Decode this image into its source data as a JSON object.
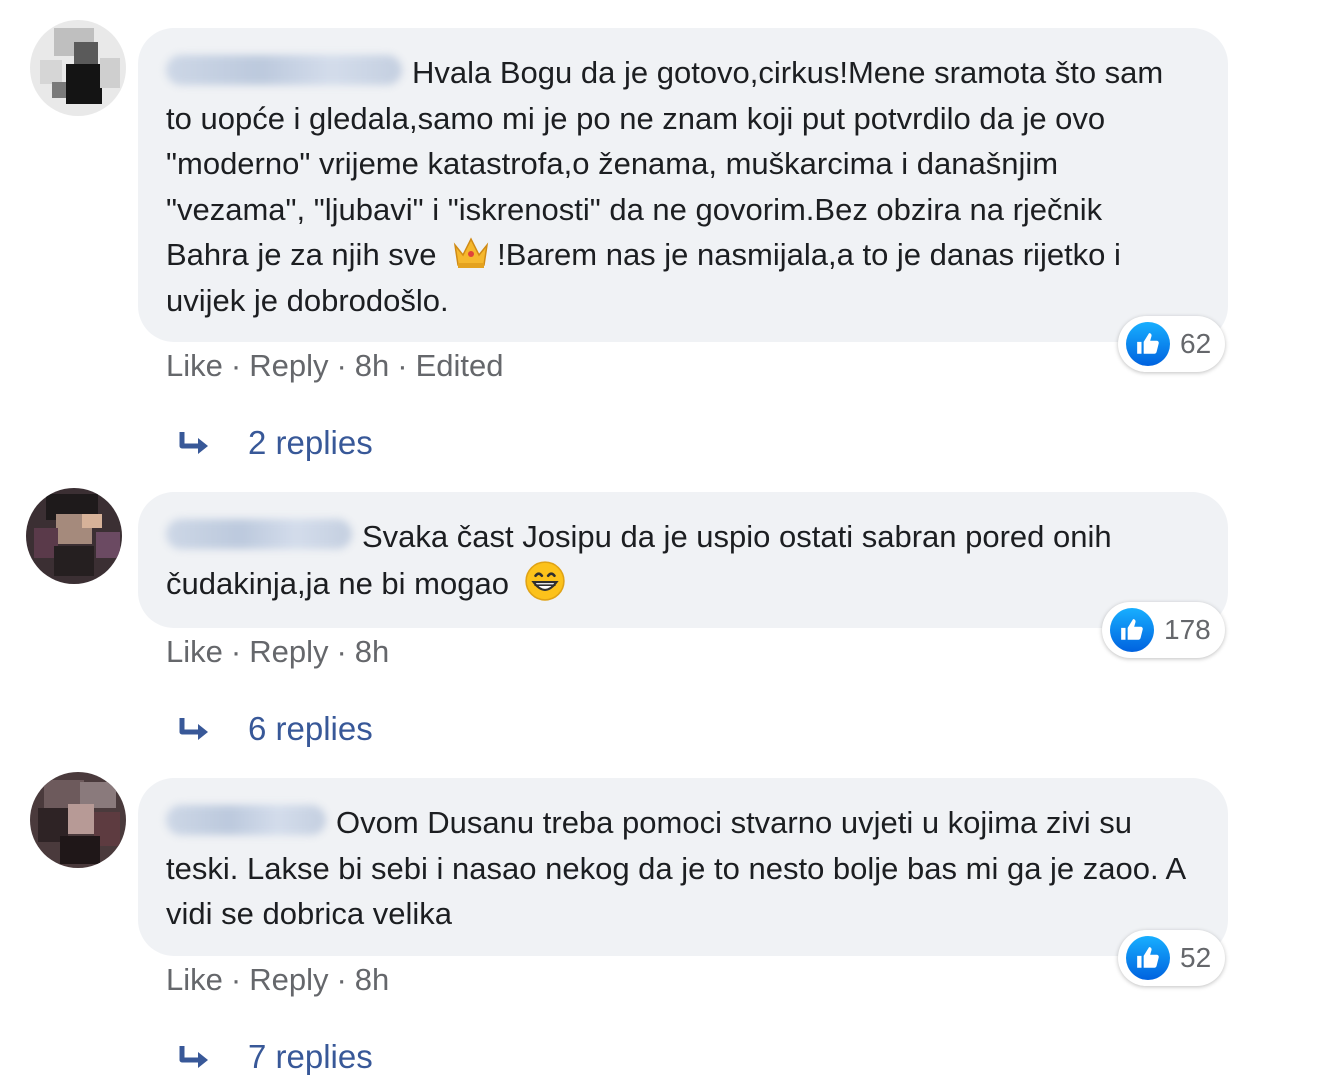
{
  "colors": {
    "bubble_bg": "#f0f2f5",
    "meta_text": "#65676b",
    "replies_link": "#385898",
    "like_badge": "#1877f2"
  },
  "comments": [
    {
      "text_before_emoji": "Hvala Bogu da je gotovo,cirkus!Mene sramota što sam to uopće i gledala,samo mi je po ne znam koji put potvrdilo da je ovo \"moderno\" vrijeme katastrofa,o ženama, muškarcima i današnjim \"vezama\", \"ljubavi\" i \"iskrenosti\" da ne govorim.Bez obzira na rječnik Bahra je za njih sve",
      "emoji": "crown-icon",
      "text_after_emoji": "!Barem nas je nasmijala,a to je danas rijetko i uvijek je dobrodošlo.",
      "reaction_icon": "like-icon",
      "reaction_count": "62",
      "actions": {
        "like": "Like",
        "reply": "Reply",
        "time": "8h",
        "edited": "Edited"
      },
      "replies_label": "2 replies"
    },
    {
      "text_before_emoji": "Svaka čast Josipu da je uspio ostati sabran pored onih čudakinja,ja ne bi mogao",
      "emoji": "grinning-face-icon",
      "text_after_emoji": "",
      "reaction_icon": "like-icon",
      "reaction_count": "178",
      "actions": {
        "like": "Like",
        "reply": "Reply",
        "time": "8h"
      },
      "replies_label": "6 replies"
    },
    {
      "text_before_emoji": "Ovom Dusanu treba pomoci stvarno uvjeti u kojima zivi su teski. Lakse bi sebi i nasao nekog da je to nesto bolje bas mi ga je zaoo. A vidi se dobrica velika",
      "emoji": "",
      "text_after_emoji": "",
      "reaction_icon": "like-icon",
      "reaction_count": "52",
      "actions": {
        "like": "Like",
        "reply": "Reply",
        "time": "8h"
      },
      "replies_label": "7 replies"
    }
  ]
}
